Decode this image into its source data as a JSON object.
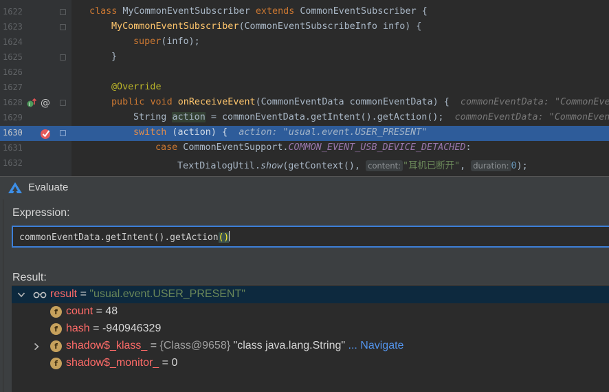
{
  "editor": {
    "lines": [
      {
        "no": "1622"
      },
      {
        "no": "1623"
      },
      {
        "no": "1624"
      },
      {
        "no": "1625"
      },
      {
        "no": "1626"
      },
      {
        "no": "1627"
      },
      {
        "no": "1628"
      },
      {
        "no": "1629"
      },
      {
        "no": "1630"
      },
      {
        "no": "1631"
      },
      {
        "no": "1632"
      }
    ],
    "code": {
      "l1622": {
        "kw1": "class",
        "name": "MyCommonEventSubscriber",
        "kw2": "extends",
        "rest": "CommonEventSubscriber {"
      },
      "l1623": {
        "fn": "MyCommonEventSubscriber",
        "rest": "(CommonEventSubscribeInfo info) {"
      },
      "l1624": {
        "kw": "super",
        "rest": "(info);"
      },
      "l1625": {
        "text": "}"
      },
      "l1627": {
        "ann": "@Override"
      },
      "l1628": {
        "kw1": "public",
        "kw2": "void",
        "fn": "onReceiveEvent",
        "rest": "(CommonEventData commonEventData) {",
        "inlay": "commonEventData: \"CommonEve"
      },
      "l1629": {
        "pre": "String ",
        "var": "action",
        "rest": " = commonEventData.getIntent().getAction();",
        "inlay": "commonEventData: \"CommonEven"
      },
      "l1630": {
        "kw": "switch",
        "rest": " (action) {",
        "inlay": "action: \"usual.event.USER_PRESENT\""
      },
      "l1631": {
        "kw": "case",
        "pre": " CommonEventSupport.",
        "field": "COMMON_EVENT_USB_DEVICE_DETACHED",
        "rest": ":"
      },
      "l1632": {
        "pre": "TextDialogUtil.",
        "fn": "show",
        "mid": "(getContext(), ",
        "hint1": "content:",
        "str": "\"耳机已断开\"",
        "comma": ", ",
        "hint2": "duration:",
        "num": "0",
        "rest": ");"
      }
    }
  },
  "dialog": {
    "title": "Evaluate",
    "expression_label": "Expression:",
    "expression_value": "commonEventData.getIntent().getAction",
    "expression_parens": "()",
    "result_label": "Result:",
    "result": {
      "root": {
        "name": "result",
        "eq": " = ",
        "value": "\"usual.event.USER_PRESENT\""
      },
      "children": [
        {
          "badge": "f",
          "name": "count",
          "eq": " = ",
          "value": "48"
        },
        {
          "badge": "f",
          "name": "hash",
          "eq": " = ",
          "value": "-940946329"
        },
        {
          "badge": "f",
          "name": "shadow$_klass_",
          "eq": " = ",
          "ref": "{Class@9658} ",
          "value": "\"class java.lang.String\"",
          "link": " ... Navigate"
        },
        {
          "badge": "f",
          "name": "shadow$_monitor_",
          "eq": " = ",
          "value": "0"
        }
      ]
    }
  },
  "colors": {
    "selection": "#2e5c9a",
    "focus_border": "#3d7fd8",
    "field_badge": "#c6a15c",
    "var_name": "#ff6b68",
    "link": "#5394ec"
  }
}
